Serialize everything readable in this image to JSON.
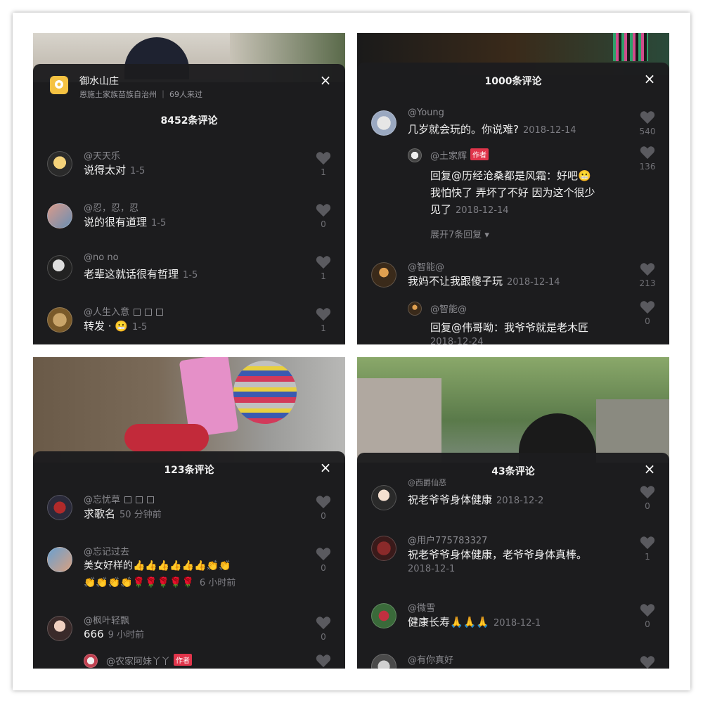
{
  "panel1": {
    "location_title": "御水山庄",
    "location_sub": "恩施土家族苗族自治州 ｜ 69人来过",
    "title": "8452条评论",
    "comments": [
      {
        "user": "@天天乐",
        "text": "说得太对",
        "time": "1-5",
        "likes": "1"
      },
      {
        "user": "@忍，忍，忍",
        "text": "说的很有道理",
        "time": "1-5",
        "likes": "0"
      },
      {
        "user": "@no no",
        "text": "老辈这就话很有哲理",
        "time": "1-5",
        "likes": "1"
      },
      {
        "user": "@人生入意",
        "text": "转发 · 😬",
        "time": "1-5",
        "likes": "1"
      }
    ]
  },
  "panel2": {
    "title": "1000条评论",
    "comments": [
      {
        "user": "@Young",
        "text": "几岁就会玩的。你说难?",
        "time": "2018-12-14",
        "likes": "540"
      },
      {
        "user": "@土家辉",
        "badge": "作者",
        "reply_line1": "回复@历经沧桑都是风霜：好吧😬",
        "reply_line2": "我怕快了 弄坏了不好 因为这个很少",
        "reply_line3": "见了",
        "time": "2018-12-14",
        "likes": "136"
      },
      {
        "expand": "展开7条回复 ▾"
      },
      {
        "user": "@智能@",
        "text": "我妈不让我跟傻子玩",
        "time": "2018-12-14",
        "likes": "213"
      },
      {
        "user": "@智能@",
        "reply_line1": "回复@伟哥呦：我爷爷就是老木匠",
        "time": "2018-12-24",
        "likes": "0"
      }
    ]
  },
  "panel3": {
    "title": "123条评论",
    "comments": [
      {
        "user": "@忘忧草",
        "text": "求歌名",
        "time": "50 分钟前",
        "likes": "0"
      },
      {
        "user": "@忘记过去",
        "text": "美女好样的👍👍👍👍👍👍👏👏",
        "text2": "👏👏👏👏🌹🌹🌹🌹🌹",
        "time": "6 小时前",
        "likes": "0"
      },
      {
        "user": "@枫叶轻飘",
        "text": "666",
        "time": "9 小时前",
        "likes": "0"
      },
      {
        "user": "@农家阿妹丫丫",
        "badge": "作者"
      }
    ]
  },
  "panel4": {
    "title": "43条评论",
    "comments": [
      {
        "user": "@西爵仙恶",
        "text": "祝老爷爷身体健康",
        "time": "2018-12-2",
        "likes": "0"
      },
      {
        "user": "@用户775783327",
        "text": "祝老爷爷身体健康，老爷爷身体真棒。",
        "time": "2018-12-1",
        "likes": "1"
      },
      {
        "user": "@微雪",
        "text": "健康长寿🙏🙏🙏",
        "time": "2018-12-1",
        "likes": "0"
      },
      {
        "user": "@有你真好"
      }
    ]
  },
  "close_glyph": "×"
}
